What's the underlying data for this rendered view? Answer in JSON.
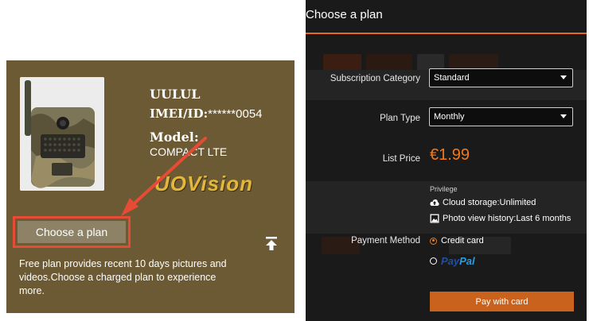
{
  "card": {
    "device_name": "UULUL",
    "imei_label": "IMEI/ID:",
    "imei_value": "******0054",
    "model_label": "Model:",
    "model_value": "COMPACT LTE",
    "brand": "UOVision",
    "choose_button": "Choose a plan",
    "free_note": "Free plan provides recent 10 days pictures and videos.Choose a charged plan to experience more.",
    "background_color": "#6b5a33",
    "highlight_color": "#e64b36"
  },
  "dialog": {
    "title": "Choose a plan",
    "accent_color": "#f07a1c",
    "subscription_category": {
      "label": "Subscription Category",
      "value": "Standard"
    },
    "plan_type": {
      "label": "Plan Type",
      "value": "Monthly"
    },
    "list_price": {
      "label": "List Price",
      "value": "€1.99"
    },
    "privilege": {
      "label": "Privilege",
      "items": [
        "Cloud storage:Unlimited",
        "Photo view history:Last 6 months"
      ]
    },
    "payment_method": {
      "label": "Payment Method",
      "options": [
        "Credit card",
        "PayPal"
      ],
      "selected": "Credit card"
    },
    "pay_button": "Pay with card"
  }
}
